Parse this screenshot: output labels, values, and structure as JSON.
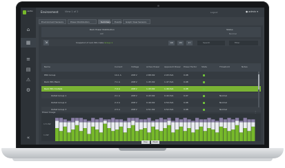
{
  "app": {
    "logo_text": "vertiv",
    "title": "Environment",
    "subtitle": "View 1 of 2",
    "top_link": "Logout",
    "user": "admin"
  },
  "tabs": [
    {
      "label": "Environment Sensors",
      "active": false
    },
    {
      "label": "Power Distribution",
      "active": false
    },
    {
      "label": "Summary",
      "active": true
    },
    {
      "label": "Events",
      "active": false
    },
    {
      "label": "Graph View Sensors",
      "active": false
    }
  ],
  "summary": {
    "label_a": "Rack Power Distribution",
    "value_a": "kW",
    "label_b": "Status",
    "value_b": "Normal"
  },
  "toolbar": {
    "icon": "expand-icon",
    "label_prefix": "Snapshot of rack PDU data",
    "label_highlight": "Group 1",
    "btn_1": "1W",
    "btn_2": "1M",
    "btn_3": "1Y",
    "field_1": "Search",
    "field_2": "Filter"
  },
  "table": {
    "headers": [
      "Name",
      "Current",
      "Voltage",
      "Active Power",
      "Apparent Power",
      "Power Factor",
      "State",
      "Threshold",
      "Notes"
    ],
    "rows": [
      {
        "name": "PDU Group",
        "current": "14.1 A",
        "voltage": "208 V",
        "power": "2.88 kW",
        "apparent": "2.93 kVA",
        "pf": "0.98",
        "state": "ok",
        "threshold": "",
        "notes": ""
      },
      {
        "name": "Rack PDU Bank",
        "current": "7.1 A",
        "voltage": "208 V",
        "power": "1.45 kW",
        "apparent": "1.47 kVA",
        "pf": "0.98",
        "state": "ok",
        "threshold": "",
        "notes": ""
      },
      {
        "name": "Rack PDU Outlets",
        "current": "7.0 A",
        "voltage": "208 V",
        "power": "1.43 kW",
        "apparent": "1.46 kVA",
        "pf": "0.98",
        "state": "ok",
        "threshold": "",
        "notes": "",
        "selected": true
      },
      {
        "name": "Outlet Group 1",
        "current": "2.1 A",
        "voltage": "208 V",
        "power": "0.43 kW",
        "apparent": "0.44 kVA",
        "pf": "0.97",
        "state": "ok",
        "threshold": "Normal",
        "notes": ""
      },
      {
        "name": "Outlet Group 2",
        "current": "2.4 A",
        "voltage": "208 V",
        "power": "0.49 kW",
        "apparent": "0.50 kVA",
        "pf": "0.98",
        "state": "ok",
        "threshold": "Normal",
        "notes": ""
      },
      {
        "name": "Outlet Group 3",
        "current": "2.5 A",
        "voltage": "208 V",
        "power": "0.51 kW",
        "apparent": "0.52 kVA",
        "pf": "0.98",
        "state": "ok",
        "threshold": "Normal",
        "notes": ""
      }
    ]
  },
  "chart_section": {
    "title": "Power Usage",
    "handle": "⋮"
  },
  "chart_data": {
    "type": "bar",
    "title": "",
    "xlabel": "",
    "ylabel": "",
    "y_tick_labels": [
      "1.5 kW",
      "1 kW"
    ],
    "ylim": [
      0,
      1.8
    ],
    "series": [
      {
        "name": "",
        "color": "#76b82a",
        "values": [
          0.9,
          0.7,
          1.0,
          0.6,
          0.8,
          1.1,
          0.7,
          0.9,
          0.5,
          1.0,
          0.8,
          0.6,
          1.2,
          0.9,
          0.7,
          0.8,
          1.0,
          0.6,
          0.9,
          1.1,
          0.7,
          0.8,
          0.9,
          0.6,
          1.0,
          0.8,
          0.7,
          0.9,
          1.1,
          0.6,
          0.8,
          1.0,
          0.7,
          0.9,
          0.6,
          0.8,
          1.0,
          0.7,
          0.9,
          0.8,
          0.6,
          1.0,
          0.9,
          0.7,
          0.8,
          1.1,
          0.6,
          0.9,
          0.7,
          1.0
        ]
      },
      {
        "name": "",
        "color": "#e9ecef",
        "values": [
          0.5,
          0.6,
          0.3,
          0.7,
          0.5,
          0.3,
          0.6,
          0.4,
          0.8,
          0.3,
          0.5,
          0.7,
          0.2,
          0.4,
          0.6,
          0.5,
          0.3,
          0.7,
          0.4,
          0.3,
          0.6,
          0.5,
          0.4,
          0.7,
          0.3,
          0.5,
          0.6,
          0.4,
          0.3,
          0.7,
          0.5,
          0.3,
          0.6,
          0.4,
          0.7,
          0.5,
          0.3,
          0.6,
          0.4,
          0.5,
          0.7,
          0.3,
          0.4,
          0.6,
          0.5,
          0.3,
          0.7,
          0.4,
          0.6,
          0.3
        ]
      },
      {
        "name": "",
        "color": "#8a7fa6",
        "values": [
          0.2,
          0.3,
          0.2,
          0.1,
          0.3,
          0.2,
          0.3,
          0.2,
          0.1,
          0.3,
          0.2,
          0.3,
          0.1,
          0.2,
          0.3,
          0.2,
          0.2,
          0.1,
          0.3,
          0.2,
          0.3,
          0.2,
          0.2,
          0.3,
          0.1,
          0.2,
          0.3,
          0.2,
          0.2,
          0.1,
          0.3,
          0.2,
          0.3,
          0.2,
          0.1,
          0.3,
          0.2,
          0.2,
          0.3,
          0.2,
          0.1,
          0.3,
          0.2,
          0.3,
          0.2,
          0.2,
          0.1,
          0.3,
          0.2,
          0.2
        ]
      }
    ],
    "grid": false,
    "legend": "none"
  },
  "chart_buttons": [
    "Day",
    "Week"
  ]
}
